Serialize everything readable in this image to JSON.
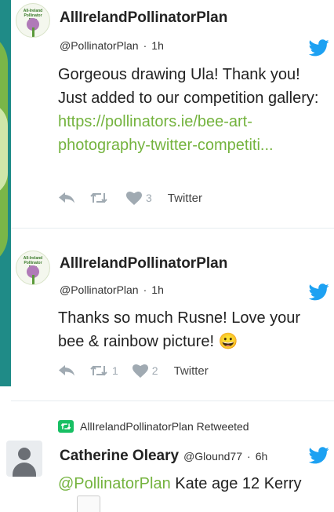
{
  "colors": {
    "twitter_blue": "#1da1f2",
    "link_green": "#74b33e",
    "strip_teal": "#1f8b87",
    "retweet_green": "#17bf63"
  },
  "tweets": [
    {
      "name": "AllIrelandPollinatorPlan",
      "handle": "@PollinatorPlan",
      "time": "1h",
      "text": "Gorgeous drawing Ula! Thank you! Just added to our competition gallery:",
      "link_line1": "https://pollinators.ie/bee-art-",
      "link_line2": "photography-twitter-competiti...",
      "likes": "3",
      "retweets": "",
      "source": "Twitter",
      "avatar_text": "All-Ireland Pollinator Plan"
    },
    {
      "name": "AllIrelandPollinatorPlan",
      "handle": "@PollinatorPlan",
      "time": "1h",
      "text_line1": "Thanks so much Rusne! Love your",
      "text_line2": "bee & rainbow picture!",
      "emoji": "😀",
      "retweets": "1",
      "likes": "2",
      "source": "Twitter",
      "avatar_text": "All-Ireland Pollinator Plan"
    }
  ],
  "retweet_item": {
    "retweeted_by": "AllIrelandPollinatorPlan Retweeted",
    "name": "Catherine Oleary",
    "handle": "@Glound77",
    "time": "6h",
    "mention": "@PollinatorPlan",
    "text": " Kate age 12 Kerry"
  },
  "separator": "·"
}
